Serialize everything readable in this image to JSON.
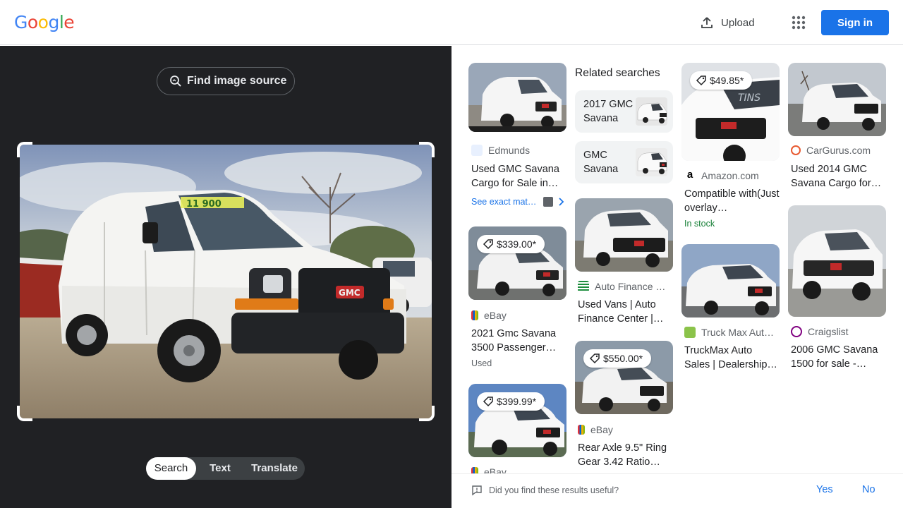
{
  "header": {
    "logo_letters": [
      {
        "ch": "G",
        "color": "#4285f4"
      },
      {
        "ch": "o",
        "color": "#ea4335"
      },
      {
        "ch": "o",
        "color": "#fbbc05"
      },
      {
        "ch": "g",
        "color": "#4285f4"
      },
      {
        "ch": "l",
        "color": "#34a853"
      },
      {
        "ch": "e",
        "color": "#ea4335"
      }
    ],
    "upload_label": "Upload",
    "signin_label": "Sign in",
    "accent": "#1a73e8"
  },
  "left_panel": {
    "find_source_label": "Find image source",
    "modes": [
      "Search",
      "Text",
      "Translate"
    ],
    "active_mode": "Search"
  },
  "results": {
    "related_heading": "Related searches",
    "related": [
      {
        "label": "2017 GMC Savana"
      },
      {
        "label": "GMC Savana"
      }
    ],
    "cards": [
      {
        "id": "c1",
        "source": "Edmunds",
        "title": "Used GMC Savana Cargo for Sale in…",
        "favicon": "blue-car-icon"
      },
      {
        "id": "c2",
        "price": "$339.00*",
        "source": "eBay",
        "title": "2021 Gmc Savana 3500 Passenger…",
        "note": "Used",
        "favicon": "ebay-icon"
      },
      {
        "id": "c3",
        "price": "$399.99*",
        "source": "eBay",
        "favicon": "ebay-icon"
      },
      {
        "id": "c4",
        "source": "Auto Finance …",
        "title": "Used Vans | Auto Finance Center |…",
        "favicon": "green-lines-icon"
      },
      {
        "id": "c5",
        "price": "$550.00*",
        "source": "eBay",
        "title": "Rear Axle 9.5\" Ring Gear 3.42 Ratio…",
        "favicon": "ebay-icon"
      },
      {
        "id": "c6",
        "price": "$49.85*",
        "source": "Amazon.com",
        "title": "Compatible with(Just overlay…",
        "note": "In stock",
        "favicon": "amazon-icon"
      },
      {
        "id": "c7",
        "source": "Truck Max Aut…",
        "title": "TruckMax Auto Sales | Dealership…",
        "favicon": "truckmax-icon"
      },
      {
        "id": "c8",
        "source": "CarGurus.com",
        "title": "Used 2014 GMC Savana Cargo for…",
        "favicon": "cargurus-icon"
      },
      {
        "id": "c9",
        "source": "Craigslist",
        "title": "2006 GMC Savana 1500 for sale -…",
        "favicon": "peace-icon"
      }
    ],
    "see_exact": "See exact mat…",
    "note_stock_color": "#188038"
  },
  "feedback": {
    "question": "Did you find these results useful?",
    "yes": "Yes",
    "no": "No"
  }
}
